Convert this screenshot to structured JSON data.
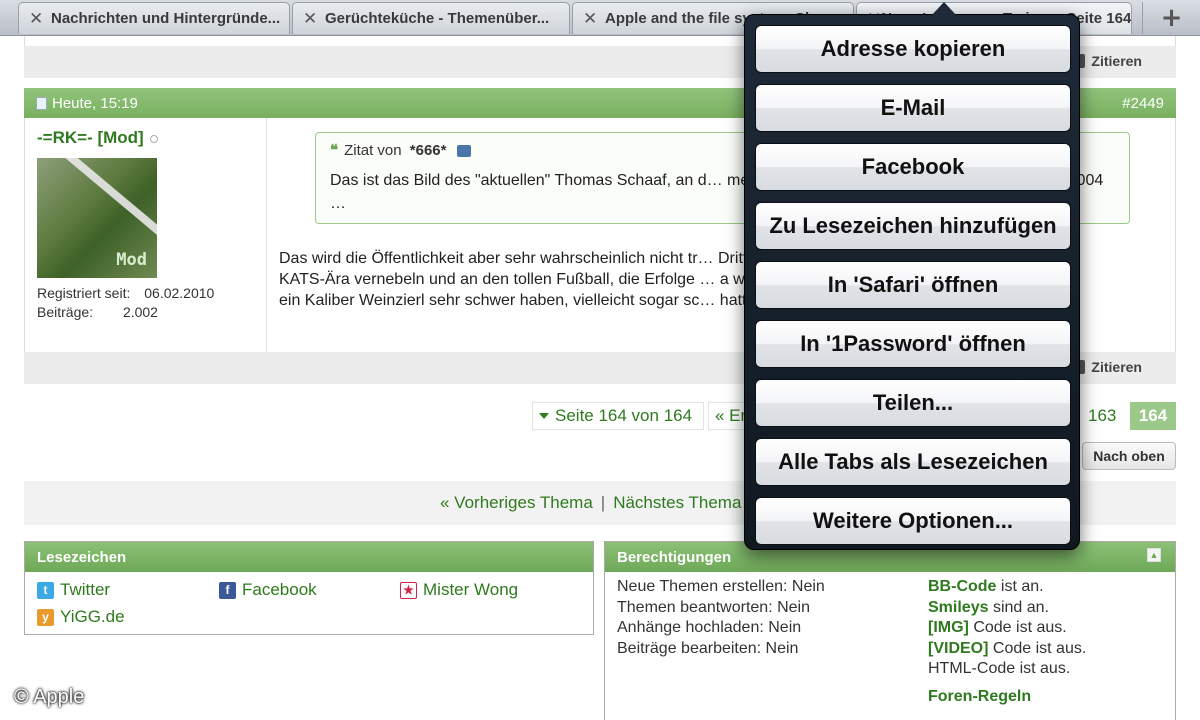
{
  "tabs": [
    {
      "label": "Nachrichten und Hintergründe..."
    },
    {
      "label": "Gerüchteküche - Themenüber..."
    },
    {
      "label": "Apple and the file system: Ske"
    },
    {
      "label": "Neue Lösungen: Trainer - Seite 164"
    }
  ],
  "new_tab": "+",
  "post": {
    "quote_action": "Zitieren",
    "date": "Heute, 15:19",
    "number": "#2449",
    "username": "-=RK=- [Mod]",
    "avatar_label": "Mod",
    "registered_label": "Registriert seit:",
    "registered_value": "06.02.2010",
    "posts_label": "Beiträge:",
    "posts_value": "2.002",
    "quote_intro": "Zitat von",
    "quote_author": "*666*",
    "quote_text": "Das ist das Bild des \"aktuellen\" Thomas Schaaf, an d… messen lassen muss und weniger an dem, was 2004 …",
    "body_line1": "Das wird die Öffentlichkeit aber sehr wahrscheinlich nicht tr…                                            Drittel der",
    "body_line2": "KATS-Ära vernebeln und an den tollen Fußball, die Erfolge …                                            a wird es",
    "body_line3": "ein Kaliber Weinzierl sehr schwer haben, vielleicht sogar sc…                                            hatte."
  },
  "pagination": {
    "page_select": "Seite 164 von 164",
    "first": "« Er",
    "prev_page": "163",
    "current_page": "164",
    "to_top": "Nach oben"
  },
  "thread_nav": {
    "previous": "« Vorheriges Thema",
    "separator": "|",
    "next": "Nächstes Thema"
  },
  "bookmarks": {
    "title": "Lesezeichen",
    "items": [
      {
        "label": "Twitter",
        "icon": "twitter-icon",
        "color": "#3ba9e6"
      },
      {
        "label": "Facebook",
        "icon": "facebook-icon",
        "color": "#3b5998"
      },
      {
        "label": "Mister Wong",
        "icon": "star-icon",
        "color": "#d6234a"
      },
      {
        "label": "YiGG.de",
        "icon": "yigg-icon",
        "color": "#e89a2c"
      }
    ]
  },
  "permissions": {
    "title": "Berechtigungen",
    "rules": [
      "Neue Themen erstellen: Nein",
      "Themen beantworten: Nein",
      "Anhänge hochladen: Nein",
      "Beiträge bearbeiten: Nein"
    ],
    "codes": [
      {
        "name": "BB-Code",
        "status": "ist an."
      },
      {
        "name": "Smileys",
        "status": "sind an."
      },
      {
        "name": "[IMG]",
        "status": "Code ist aus."
      },
      {
        "name": "[VIDEO]",
        "status": "Code ist aus."
      }
    ],
    "html_code": "HTML-Code ist aus.",
    "forum_rules": "Foren-Regeln"
  },
  "copyright": "© Apple",
  "menu": {
    "items": [
      "Adresse kopieren",
      "E-Mail",
      "Facebook",
      "Zu Lesezeichen hinzufügen",
      "In 'Safari' öffnen",
      "In '1Password' öffnen",
      "Teilen...",
      "Alle Tabs als Lesezeichen",
      "Weitere Optionen..."
    ]
  },
  "colors": {
    "accent_green": "#78b05f",
    "link_green": "#2f7a1f"
  }
}
